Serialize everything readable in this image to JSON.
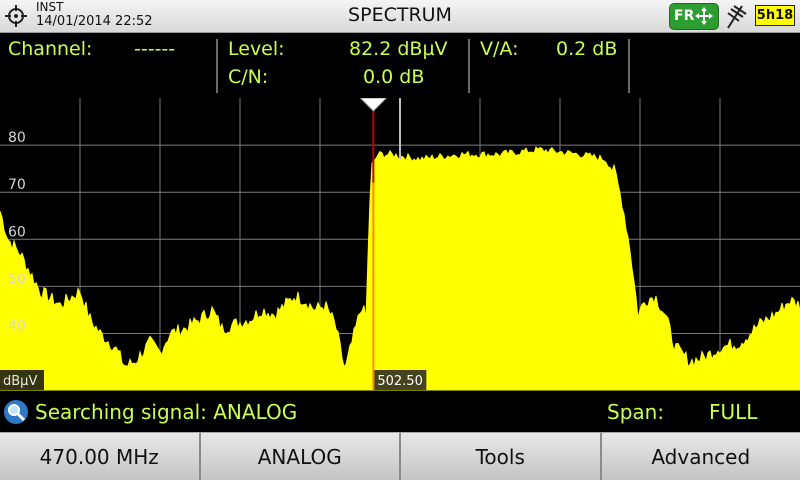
{
  "header": {
    "mode": "INST",
    "datetime": "14/01/2014 22:52",
    "title": "SPECTRUM",
    "region_badge": "FR",
    "battery": "5h18",
    "icons": [
      "crosshair-icon",
      "move-arrows-icon",
      "antenna-icon",
      "battery-icon"
    ]
  },
  "readout": {
    "channel_label": "Channel:",
    "channel_value": "------",
    "level_label": "Level:",
    "level_value": "82.2 dBµV",
    "cn_label": "C/N:",
    "cn_value": "0.0 dB",
    "va_label": "V/A:",
    "va_value": "0.2 dB"
  },
  "status": {
    "searching": "Searching signal: ANALOG",
    "span_label": "Span:",
    "span_value": "FULL"
  },
  "buttons": {
    "freq": "470.00 MHz",
    "signal": "ANALOG",
    "tools": "Tools",
    "advanced": "Advanced"
  },
  "colors": {
    "trace": "#ffff00",
    "readout_text": "#c8ff50",
    "marker": "#c00000",
    "badge_green": "#2e9d31"
  },
  "chart_data": {
    "type": "area",
    "ylabel": "dBµV",
    "yticks": [
      40,
      50,
      60,
      70,
      80
    ],
    "ylim": [
      28,
      90
    ],
    "marker_label": "502.50",
    "marker_x_frac": 0.4667,
    "grid": true,
    "envelope": [
      [
        0,
        66
      ],
      [
        8,
        60
      ],
      [
        20,
        57
      ],
      [
        40,
        49
      ],
      [
        60,
        46
      ],
      [
        80,
        49
      ],
      [
        90,
        43
      ],
      [
        100,
        40
      ],
      [
        115,
        37
      ],
      [
        125,
        33
      ],
      [
        135,
        34
      ],
      [
        150,
        38
      ],
      [
        160,
        36
      ],
      [
        170,
        40
      ],
      [
        185,
        41
      ],
      [
        200,
        43
      ],
      [
        212,
        45
      ],
      [
        222,
        41
      ],
      [
        235,
        42
      ],
      [
        250,
        43
      ],
      [
        262,
        45
      ],
      [
        275,
        44
      ],
      [
        285,
        46
      ],
      [
        295,
        48
      ],
      [
        305,
        47
      ],
      [
        315,
        45
      ],
      [
        325,
        46
      ],
      [
        335,
        42
      ],
      [
        345,
        32
      ],
      [
        352,
        38
      ],
      [
        362,
        46
      ],
      [
        366,
        43
      ],
      [
        371,
        75
      ],
      [
        378,
        78
      ],
      [
        390,
        78
      ],
      [
        420,
        77
      ],
      [
        460,
        78
      ],
      [
        500,
        78
      ],
      [
        540,
        79
      ],
      [
        580,
        78
      ],
      [
        605,
        77
      ],
      [
        615,
        74
      ],
      [
        622,
        68
      ],
      [
        630,
        58
      ],
      [
        638,
        44
      ],
      [
        645,
        47
      ],
      [
        655,
        48
      ],
      [
        665,
        44
      ],
      [
        675,
        37
      ],
      [
        690,
        34
      ],
      [
        705,
        35
      ],
      [
        720,
        37
      ],
      [
        740,
        38
      ],
      [
        760,
        42
      ],
      [
        775,
        44
      ],
      [
        790,
        47
      ],
      [
        800,
        46
      ]
    ]
  }
}
